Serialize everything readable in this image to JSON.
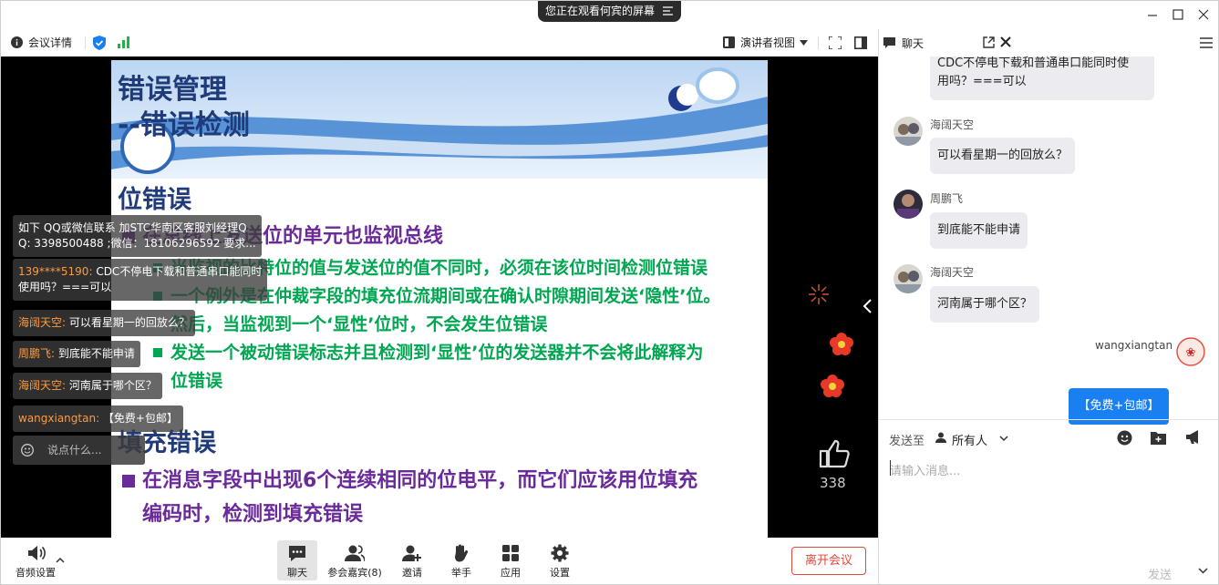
{
  "titlebar": {
    "share_notice": "您正在观看何宾的屏幕"
  },
  "toolbar": {
    "meeting_details": "会议详情",
    "view_mode": "演讲者视图"
  },
  "slide": {
    "title_line1": "错误管理",
    "title_line2": "--错误检测",
    "section1": "位错误",
    "s1_bullet1": "在总线上发送位的单元也监视总线",
    "s1_sub1": "当监视的比特位的值与发送位的值不同时，必须在该位时间检测位错误",
    "s1_sub2_line1": "一个例外是在仲裁字段的填充位流期间或在确认时隙期间发送‘隐性’位。",
    "s1_sub2_line2": "然后，当监视到一个‘显性’位时，不会发生位错误",
    "s1_sub3_line1": "发送一个被动错误标志并且检测到‘显性’位的发送器并不会将此解释为",
    "s1_sub3_line2": "位错误",
    "section2": "填充错误",
    "s2_bullet1_line1": "在消息字段中出现6个连续相同的位电平，而它们应该用位填充",
    "s2_bullet1_line2": "编码时，检测到填充错误"
  },
  "danmaku": {
    "notice_line1": "如下 QQ或微信联系  加STC华南区客服刘经理Q",
    "notice_line2": "Q: 3398500488 ;微信：18106296592  要求...",
    "items": [
      {
        "name": "139****5190:",
        "text_line1": " CDC不停电下载和普通串口能同时",
        "text_line2": "使用吗？===可以"
      },
      {
        "name": "海阔天空:",
        "text": " 可以看星期一的回放么？"
      },
      {
        "name": "周鹏飞:",
        "text": " 到底能不能申请"
      },
      {
        "name": "海阔天空:",
        "text": " 河南属于哪个区？"
      },
      {
        "name": "wangxiangtan:",
        "text": " 【免费+包邮】"
      }
    ],
    "input_placeholder": "说点什么..."
  },
  "likes": {
    "count": "338"
  },
  "bottom": {
    "audio": "音频设置",
    "chat": "聊天",
    "participants": "参会嘉宾(8)",
    "invite": "邀请",
    "raise_hand": "举手",
    "apps": "应用",
    "settings": "设置",
    "leave": "离开会议"
  },
  "chat": {
    "title": "聊天",
    "messages": [
      {
        "sender": "",
        "text_line1": "CDC不停电下载和普通串口能同时使",
        "text_line2": "用吗？===可以"
      },
      {
        "sender": "海阔天空",
        "text": "可以看星期一的回放么？"
      },
      {
        "sender": "周鹏飞",
        "text": "到底能不能申请"
      },
      {
        "sender": "海阔天空",
        "text": "河南属于哪个区？"
      },
      {
        "sender": "wangxiangtan",
        "text": "【免费+包邮】"
      }
    ],
    "send_to_label": "发送至",
    "send_to_value": "所有人",
    "input_placeholder": "请输入消息...",
    "send_label": "发送"
  },
  "colors": {
    "accent": "#1a7ff0",
    "leave": "#e04a3a",
    "slide_purple": "#6b2a9a",
    "slide_green": "#00a651",
    "slide_navy": "#1f3b79"
  }
}
